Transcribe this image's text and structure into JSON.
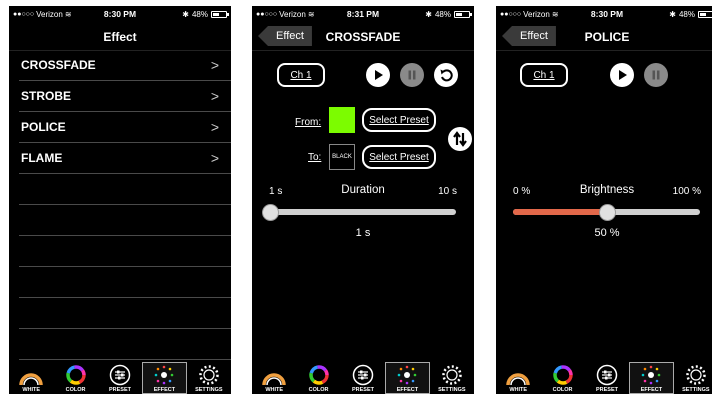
{
  "phones": [
    {
      "status": {
        "carrier": "Verizon",
        "time": "8:30 PM",
        "battery": "48%"
      },
      "title": "Effect",
      "items": [
        {
          "label": "CROSSFADE"
        },
        {
          "label": "STROBE"
        },
        {
          "label": "POLICE"
        },
        {
          "label": "FLAME"
        }
      ]
    },
    {
      "status": {
        "carrier": "Verizon",
        "time": "8:31 PM",
        "battery": "48%"
      },
      "back": "Effect",
      "title": "CROSSFADE",
      "channel": "Ch 1",
      "from_label": "From:",
      "to_label": "To:",
      "from_color": "#7cfc00",
      "to_swatch_text": "BLACK",
      "select_preset": "Select Preset",
      "duration_label": "Duration",
      "duration_min": "1 s",
      "duration_max": "10 s",
      "duration_value": "1 s",
      "duration_level": 0.0
    },
    {
      "status": {
        "carrier": "Verizon",
        "time": "8:30 PM",
        "battery": "48%"
      },
      "back": "Effect",
      "title": "POLICE",
      "channel": "Ch 1",
      "brightness_label": "Brightness",
      "brightness_min": "0 %",
      "brightness_max": "100 %",
      "brightness_value": "50 %",
      "brightness_level": 0.5
    }
  ],
  "tabs": [
    "WHITE",
    "COLOR",
    "PRESET",
    "EFFECT",
    "SETTINGS"
  ],
  "active_tab": "EFFECT",
  "colors": {
    "accent_slider": "#e2684a",
    "from_swatch": "#7cfc00"
  }
}
